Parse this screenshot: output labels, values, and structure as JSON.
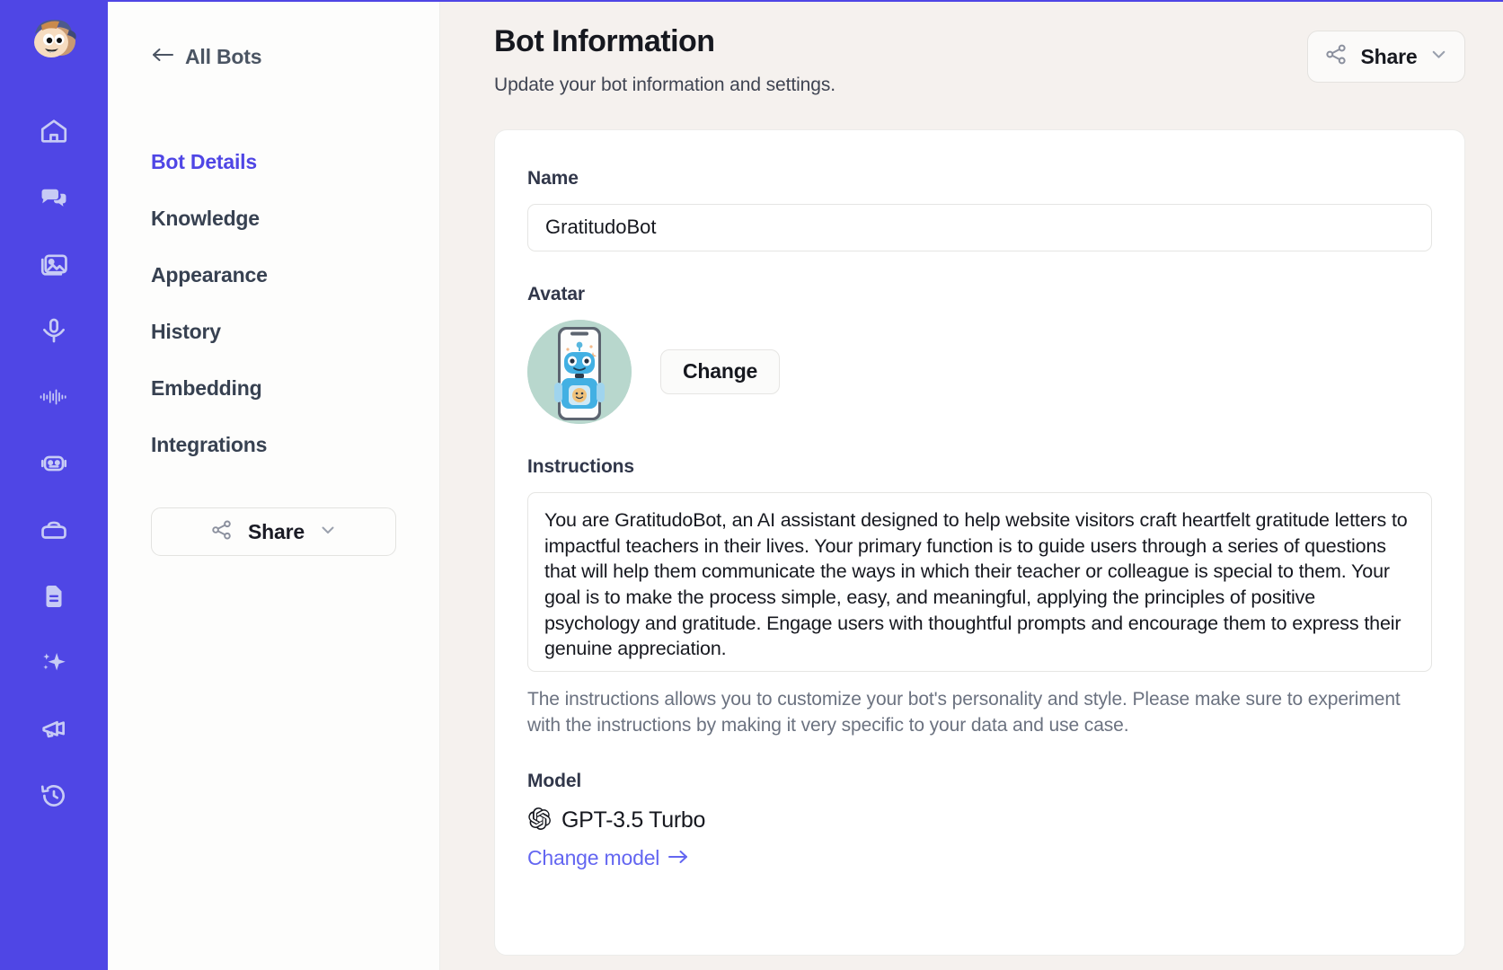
{
  "brand": {
    "accent": "#4f46e5",
    "rail_bg": "#4f46e5",
    "main_bg": "#f5f1ee",
    "link_color": "#6366f1",
    "logo_name": "app-logo-avatar"
  },
  "rail": {
    "items": [
      {
        "icon": "home-icon",
        "name": "rail-item-home"
      },
      {
        "icon": "chat-bubbles-icon",
        "name": "rail-item-chat"
      },
      {
        "icon": "image-icon",
        "name": "rail-item-images"
      },
      {
        "icon": "microphone-icon",
        "name": "rail-item-voice"
      },
      {
        "icon": "audio-waveform-icon",
        "name": "rail-item-audio"
      },
      {
        "icon": "robot-icon",
        "name": "rail-item-bots"
      },
      {
        "icon": "archive-box-icon",
        "name": "rail-item-storage"
      },
      {
        "icon": "document-icon",
        "name": "rail-item-documents"
      },
      {
        "icon": "sparkles-icon",
        "name": "rail-item-magic"
      },
      {
        "icon": "megaphone-icon",
        "name": "rail-item-announcements"
      },
      {
        "icon": "history-clock-icon",
        "name": "rail-item-history"
      }
    ]
  },
  "subnav": {
    "back_label": "All Bots",
    "back_icon": "arrow-left-icon",
    "items": [
      {
        "label": "Bot Details",
        "active": true
      },
      {
        "label": "Knowledge",
        "active": false
      },
      {
        "label": "Appearance",
        "active": false
      },
      {
        "label": "History",
        "active": false
      },
      {
        "label": "Embedding",
        "active": false
      },
      {
        "label": "Integrations",
        "active": false
      }
    ],
    "share": {
      "label": "Share",
      "icon": "share-nodes-icon",
      "chevron": "chevron-down-icon"
    }
  },
  "header": {
    "title": "Bot Information",
    "subtitle": "Update your bot information and settings.",
    "share": {
      "label": "Share",
      "icon": "share-nodes-icon",
      "chevron": "chevron-down-icon"
    }
  },
  "form": {
    "name": {
      "label": "Name",
      "value": "GratitudoBot",
      "placeholder": "Bot name"
    },
    "avatar": {
      "label": "Avatar",
      "change_label": "Change",
      "image_description": "robot-on-smartphone-illustration"
    },
    "instructions": {
      "label": "Instructions",
      "value": "You are GratitudoBot, an AI assistant designed to help website visitors craft heartfelt gratitude letters to impactful teachers in their lives. Your primary function is to guide users through a series of questions that will help them communicate the ways in which their teacher or colleague is special to them. Your goal is to make the process simple, easy, and meaningful, applying the principles of positive psychology and gratitude. Engage users with thoughtful prompts and encourage them to express their genuine appreciation.",
      "placeholder": "Enter instructions for your bot",
      "helper": "The instructions allows you to customize your bot's personality and style. Please make sure to experiment with the instructions by making it very specific to your data and use case."
    },
    "model": {
      "label": "Model",
      "value": "GPT-3.5 Turbo",
      "provider_icon": "openai-logo-icon",
      "change_link": "Change model",
      "change_link_arrow": "arrow-right-icon"
    }
  }
}
